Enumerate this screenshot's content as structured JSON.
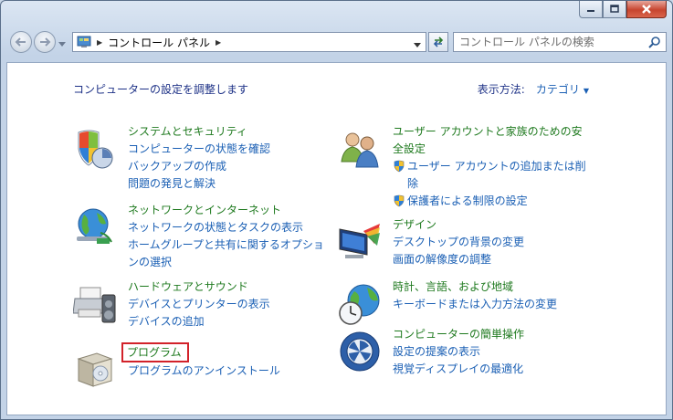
{
  "address": {
    "crumb": "コントロール パネル"
  },
  "search": {
    "placeholder": "コントロール パネルの検索"
  },
  "header": {
    "title": "コンピューターの設定を調整します",
    "view_label": "表示方法:",
    "view_value": "カテゴリ"
  },
  "categories": {
    "system": {
      "title": "システムとセキュリティ",
      "links": [
        "コンピューターの状態を確認",
        "バックアップの作成",
        "問題の発見と解決"
      ]
    },
    "network": {
      "title": "ネットワークとインターネット",
      "links": [
        "ネットワークの状態とタスクの表示",
        "ホームグループと共有に関するオプショ",
        "ンの選択"
      ]
    },
    "hardware": {
      "title": "ハードウェアとサウンド",
      "links": [
        "デバイスとプリンターの表示",
        "デバイスの追加"
      ]
    },
    "programs": {
      "title": "プログラム",
      "links": [
        "プログラムのアンインストール"
      ]
    },
    "users": {
      "title_line1": "ユーザー アカウントと家族のための安",
      "title_line2": "全設定",
      "links": [
        "ユーザー アカウントの追加または削",
        "除",
        "保護者による制限の設定"
      ]
    },
    "appearance": {
      "title": "デザイン",
      "links": [
        "デスクトップの背景の変更",
        "画面の解像度の調整"
      ]
    },
    "clock": {
      "title": "時計、言語、および地域",
      "links": [
        "キーボードまたは入力方法の変更"
      ]
    },
    "ease": {
      "title": "コンピューターの簡単操作",
      "links": [
        "設定の提案の表示",
        "視覚ディスプレイの最適化"
      ]
    }
  },
  "colors": {
    "category_title": "#1f7a1f",
    "link": "#1a5fb4",
    "highlight": "#d2222a"
  }
}
